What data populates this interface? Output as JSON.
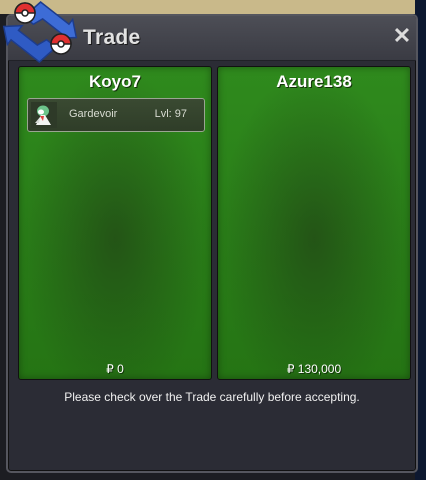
{
  "window": {
    "title": "Trade",
    "close_label": "✕"
  },
  "left_player": {
    "name": "Koyo7",
    "money": "₽ 0",
    "pokemon": [
      {
        "name": "Gardevoir",
        "level": "Lvl: 97",
        "icon": "gardevoir-sprite-icon"
      }
    ]
  },
  "right_player": {
    "name": "Azure138",
    "money": "₽ 130,000",
    "pokemon": []
  },
  "notice": "Please check over the Trade carefully before accepting.",
  "colors": {
    "panel_green": "#2a8019",
    "window_bg": "#2b2c35",
    "titlebar": "#44454d"
  }
}
